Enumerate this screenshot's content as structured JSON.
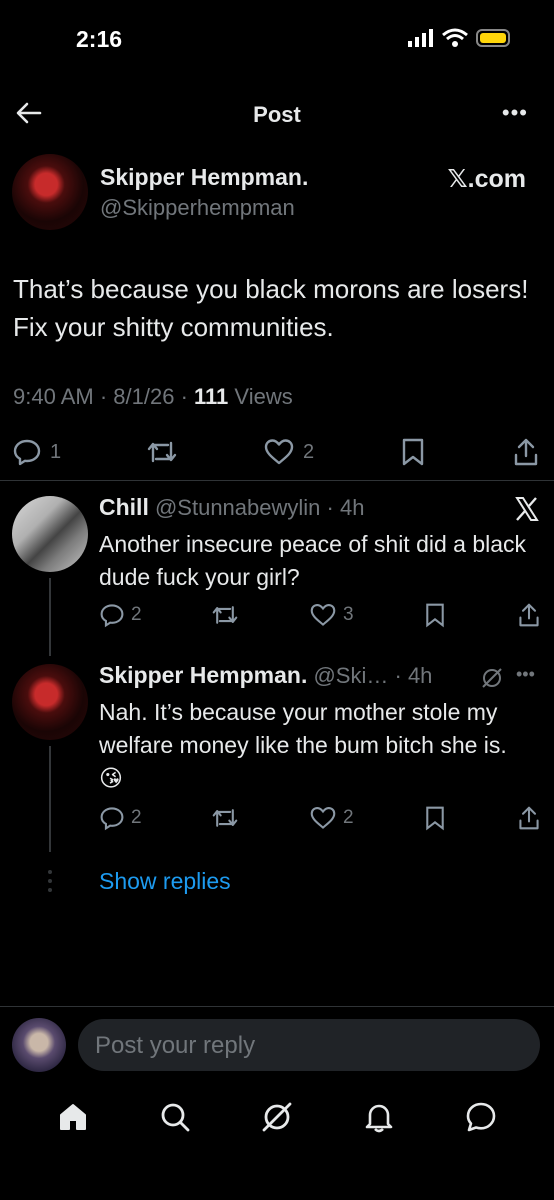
{
  "status_bar": {
    "time": "2:16"
  },
  "header": {
    "title": "Post"
  },
  "main_post": {
    "author_name": "Skipper Hempman.",
    "author_handle": "@Skipperhempman",
    "source_label": "𝕏.com",
    "text": "That’s because you black morons are losers! Fix your shitty communities.",
    "time": "9:40 AM",
    "date": "8/1/26",
    "views_count": "111",
    "views_label": "Views",
    "replies": "1",
    "likes": "2"
  },
  "replies": [
    {
      "name": "Chill",
      "handle": "@Stunnabewylin",
      "time": "4h",
      "text": "Another insecure peace of shit did a black dude fuck your girl?",
      "replies": "2",
      "likes": "3"
    },
    {
      "name": "Skipper Hempman.",
      "handle": "@Ski…",
      "time": "4h",
      "text": "Nah. It’s because your mother stole my welfare money like the bum bitch she is. 😘",
      "replies": "2",
      "likes": "2"
    }
  ],
  "show_replies_label": "Show replies",
  "reply_input": {
    "placeholder": "Post your reply"
  },
  "colors": {
    "background": "#000000",
    "text": "#e7e9ea",
    "muted": "#71767b",
    "accent": "#1d9bf0",
    "battery": "#ffd60a"
  },
  "icons": {
    "tab_bar": [
      "home-icon",
      "search-icon",
      "grok-icon",
      "notifications-icon",
      "messages-icon"
    ],
    "post_actions": [
      "reply-icon",
      "repost-icon",
      "like-icon",
      "bookmark-icon",
      "share-icon"
    ]
  }
}
